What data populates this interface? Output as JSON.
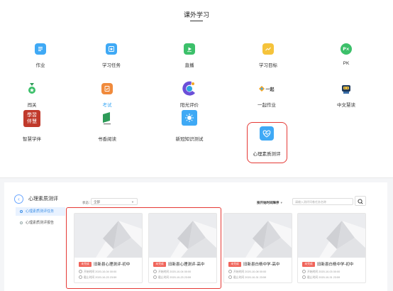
{
  "header": {
    "title": "课外学习"
  },
  "apps": [
    {
      "label": "作业",
      "icon": "homework-icon",
      "color": "#3fa9f5"
    },
    {
      "label": "学习任务",
      "icon": "star-task-icon",
      "color": "#3fa9f5"
    },
    {
      "label": "直播",
      "icon": "live-play-icon",
      "color": "#3cc06a"
    },
    {
      "label": "学习目标",
      "icon": "goal-chart-icon",
      "color": "#f5c33b"
    },
    {
      "label": "PK",
      "icon": "pk-icon",
      "color": "#3cc06a"
    },
    {
      "label": "闯关",
      "icon": "medal-icon",
      "color": "#3cc06a"
    },
    {
      "label": "考试",
      "icon": "exam-icon",
      "color": "#f08a3c",
      "active": true
    },
    {
      "label": "阳光评价",
      "icon": "sunshine-eval-icon",
      "color": "#6b4fd8"
    },
    {
      "label": "一起作业",
      "icon": "together-homework-logo",
      "color": "#f5a623",
      "logo_text": "一起"
    },
    {
      "label": "中文慧读",
      "icon": "robot-reader-icon",
      "color": "#3a6ea8"
    },
    {
      "label": "智慧学伴",
      "icon": "smart-companion-logo",
      "color": "#c0392b",
      "logo_text": "學習伴慧"
    },
    {
      "label": "书香阅读",
      "icon": "book-reading-icon",
      "color": "#2e9b58"
    },
    {
      "label": "新冠知识测试",
      "icon": "covid-test-icon",
      "color": "#3fa9f5"
    },
    {
      "label": "心理素质测评",
      "icon": "heart-monitor-icon",
      "color": "#3fa9f5",
      "highlighted": true
    }
  ],
  "panel": {
    "back_icon": "back-arrow-icon",
    "title": "心理素质测评",
    "sidebar": [
      {
        "label": "心理素质测评任务",
        "active": true
      },
      {
        "label": "心理素质测评报告",
        "active": false
      }
    ],
    "filter_label": "状态：",
    "filter_value": "全部",
    "sort_label": "按开始时间降序",
    "search_placeholder": "请输入测评问卷任务名称",
    "cards": [
      {
        "badge": "未完成",
        "title": "旧新县心理测评-初中",
        "start": "开始时间 2020-10-04 00:00",
        "end": "截止时间 2020-10-23 23:59"
      },
      {
        "badge": "未完成",
        "title": "旧新县心理测评-高中",
        "start": "开始时间 2020-10-04 00:00",
        "end": "截止时间 2020-10-23 23:59"
      },
      {
        "badge": "未完成",
        "title": "旧新县白杨中学-高中",
        "start": "开始时间 2020-10-08 00:00",
        "end": "截止时间 2020-10-31 23:59"
      },
      {
        "badge": "未完成",
        "title": "旧新县白杨中学-初中",
        "start": "开始时间 2020-10-03 00:00",
        "end": "截止时间 2020-10-31 23:59"
      }
    ]
  }
}
